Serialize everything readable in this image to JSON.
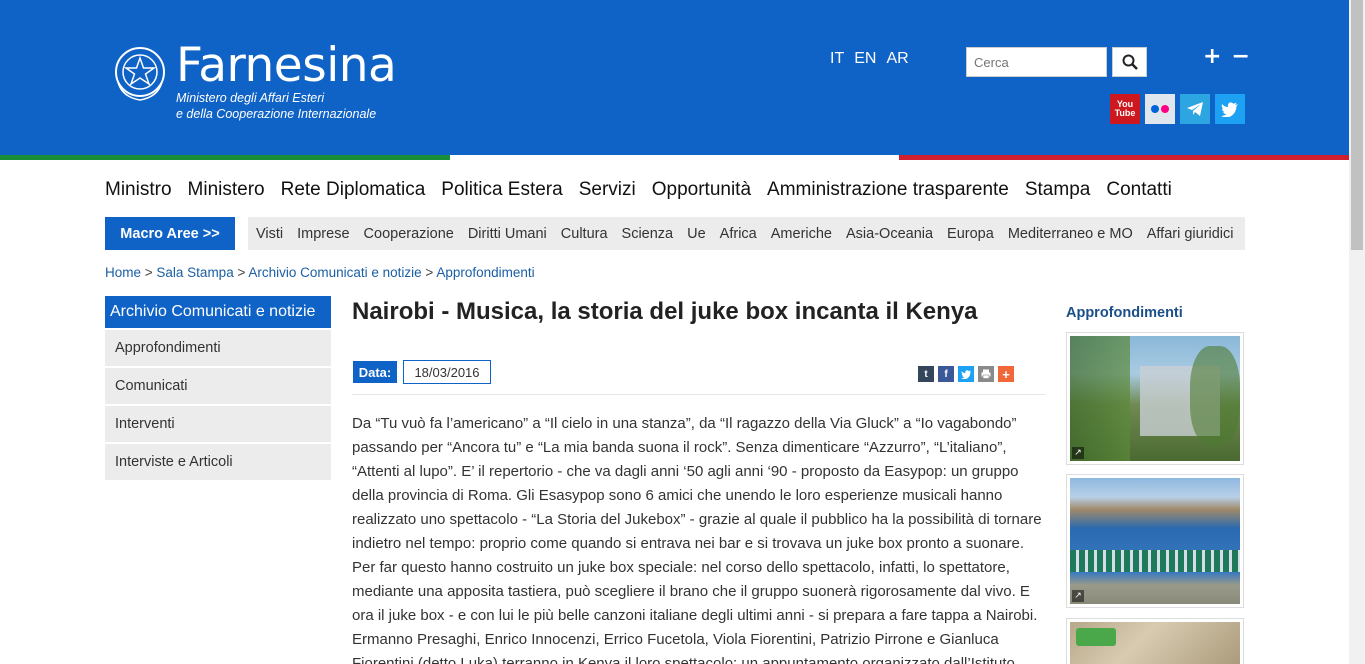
{
  "header": {
    "logo_title": "Farnesina",
    "logo_sub_1": "Ministero degli Affari Esteri",
    "logo_sub_2": "e della Cooperazione Internazionale",
    "languages": [
      "IT",
      "EN",
      "AR"
    ],
    "search_placeholder": "Cerca",
    "zoom_in": "+",
    "zoom_out": "−",
    "social": [
      {
        "name": "youtube-icon",
        "color": "#cc181e",
        "text": "You Tube"
      },
      {
        "name": "flickr-icon",
        "color": "#e0e6ee"
      },
      {
        "name": "telegram-icon",
        "color": "#2ca5e0"
      },
      {
        "name": "twitter-icon",
        "color": "#1da1f2"
      }
    ],
    "bg_color": "#0f62c6",
    "flag_colors": [
      "#1a8f3a",
      "#ffffff",
      "#d0202f"
    ]
  },
  "main_nav": [
    "Ministro",
    "Ministero",
    "Rete Diplomatica",
    "Politica Estera",
    "Servizi",
    "Opportunità",
    "Amministrazione trasparente",
    "Stampa",
    "Contatti"
  ],
  "macro_button": "Macro Aree >>",
  "sub_nav": [
    "Visti",
    "Imprese",
    "Cooperazione",
    "Diritti Umani",
    "Cultura",
    "Scienza",
    "Ue",
    "Africa",
    "Americhe",
    "Asia-Oceania",
    "Europa",
    "Mediterraneo e MO",
    "Affari giuridici"
  ],
  "breadcrumb": {
    "items": [
      "Home",
      "Sala Stampa",
      "Archivio Comunicati e notizie",
      "Approfondimenti"
    ],
    "separator": " > "
  },
  "sidebar": {
    "title": "Archivio Comunicati e notizie",
    "items": [
      "Approfondimenti",
      "Comunicati",
      "Interventi",
      "Interviste e Articoli"
    ]
  },
  "article": {
    "title": "Nairobi - Musica, la storia del juke box incanta il Kenya",
    "date_label": "Data:",
    "date_value": "18/03/2016",
    "share_icons": [
      {
        "name": "tumblr-icon",
        "color": "#35465c",
        "glyph": "t"
      },
      {
        "name": "facebook-icon",
        "color": "#3b5998",
        "glyph": "f"
      },
      {
        "name": "twitter-share-icon",
        "color": "#1da1f2",
        "glyph": "t"
      },
      {
        "name": "print-icon",
        "color": "#8a8a8a",
        "glyph": "⎙"
      },
      {
        "name": "more-icon",
        "color": "#f0673a",
        "glyph": "+"
      }
    ],
    "body": "Da “Tu vuò fa l’americano” a “Il cielo in una stanza”, da “Il ragazzo della Via Gluck” a “Io vagabondo” passando per “Ancora tu” e “La mia banda suona il rock”. Senza dimenticare “Azzurro”, “L’italiano”, “Attenti al lupo”. E’ il repertorio - che va dagli anni ‘50 agli anni ‘90 - proposto da Easypop: un gruppo della provincia di Roma. Gli Esasypop sono 6 amici che unendo le loro esperienze musicali hanno realizzato uno spettacolo - “La Storia del Jukebox” - grazie al quale il pubblico ha la possibilità di tornare indietro nel tempo: proprio come quando si entrava nei bar e si trovava un juke box pronto a suonare. Per far questo hanno costruito un juke box speciale: nel corso dello spettacolo, infatti, lo spettatore, mediante una apposita tastiera, può scegliere il brano che il gruppo suonerà rigorosamente dal vivo. E ora il juke box - e con lui le più belle canzoni italiane degli ultimi anni - si prepara a fare tappa a Nairobi. Ermanno Presaghi, Enrico Innocenzi, Errico Fucetola, Viola Fiorentini, Patrizio Pirrone e Gianluca Fiorentini (detto Luka) terranno in Kenya il loro spettacolo: un appuntamento organizzato dall’Istituto"
  },
  "right_column": {
    "title": "Approfondimenti"
  }
}
